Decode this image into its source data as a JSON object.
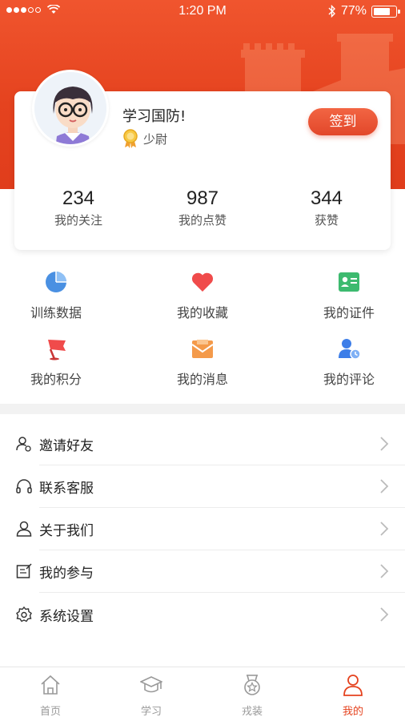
{
  "status_bar": {
    "time": "1:20 PM",
    "battery": "77%",
    "battery_level": 0.77
  },
  "profile": {
    "username": "学习国防!",
    "rank": "少尉",
    "signin_label": "签到"
  },
  "stats": [
    {
      "value": "234",
      "label": "我的关注"
    },
    {
      "value": "987",
      "label": "我的点赞"
    },
    {
      "value": "344",
      "label": "获赞"
    }
  ],
  "grid": [
    {
      "label": "训练数据",
      "icon": "pie-chart-icon",
      "color": "#4a90e2"
    },
    {
      "label": "我的收藏",
      "icon": "heart-icon",
      "color": "#f04b4b"
    },
    {
      "label": "我的证件",
      "icon": "id-card-icon",
      "color": "#3dba6f"
    },
    {
      "label": "我的积分",
      "icon": "flag-icon",
      "color": "#f04b4b"
    },
    {
      "label": "我的消息",
      "icon": "envelope-icon",
      "color": "#f49a4a"
    },
    {
      "label": "我的评论",
      "icon": "user-comment-icon",
      "color": "#3d7ee8"
    }
  ],
  "menu": [
    {
      "label": "邀请好友",
      "icon": "invite-user-icon"
    },
    {
      "label": "联系客服",
      "icon": "headphones-icon"
    },
    {
      "label": "关于我们",
      "icon": "user-icon"
    },
    {
      "label": "我的参与",
      "icon": "edit-document-icon"
    },
    {
      "label": "系统设置",
      "icon": "gear-icon"
    }
  ],
  "tabs": [
    {
      "label": "首页",
      "icon": "home-icon"
    },
    {
      "label": "学习",
      "icon": "graduation-cap-icon"
    },
    {
      "label": "戎装",
      "icon": "medal-icon"
    },
    {
      "label": "我的",
      "icon": "person-icon",
      "active": true
    }
  ],
  "colors": {
    "brand": "#e5431f",
    "accent": "#f26543"
  }
}
